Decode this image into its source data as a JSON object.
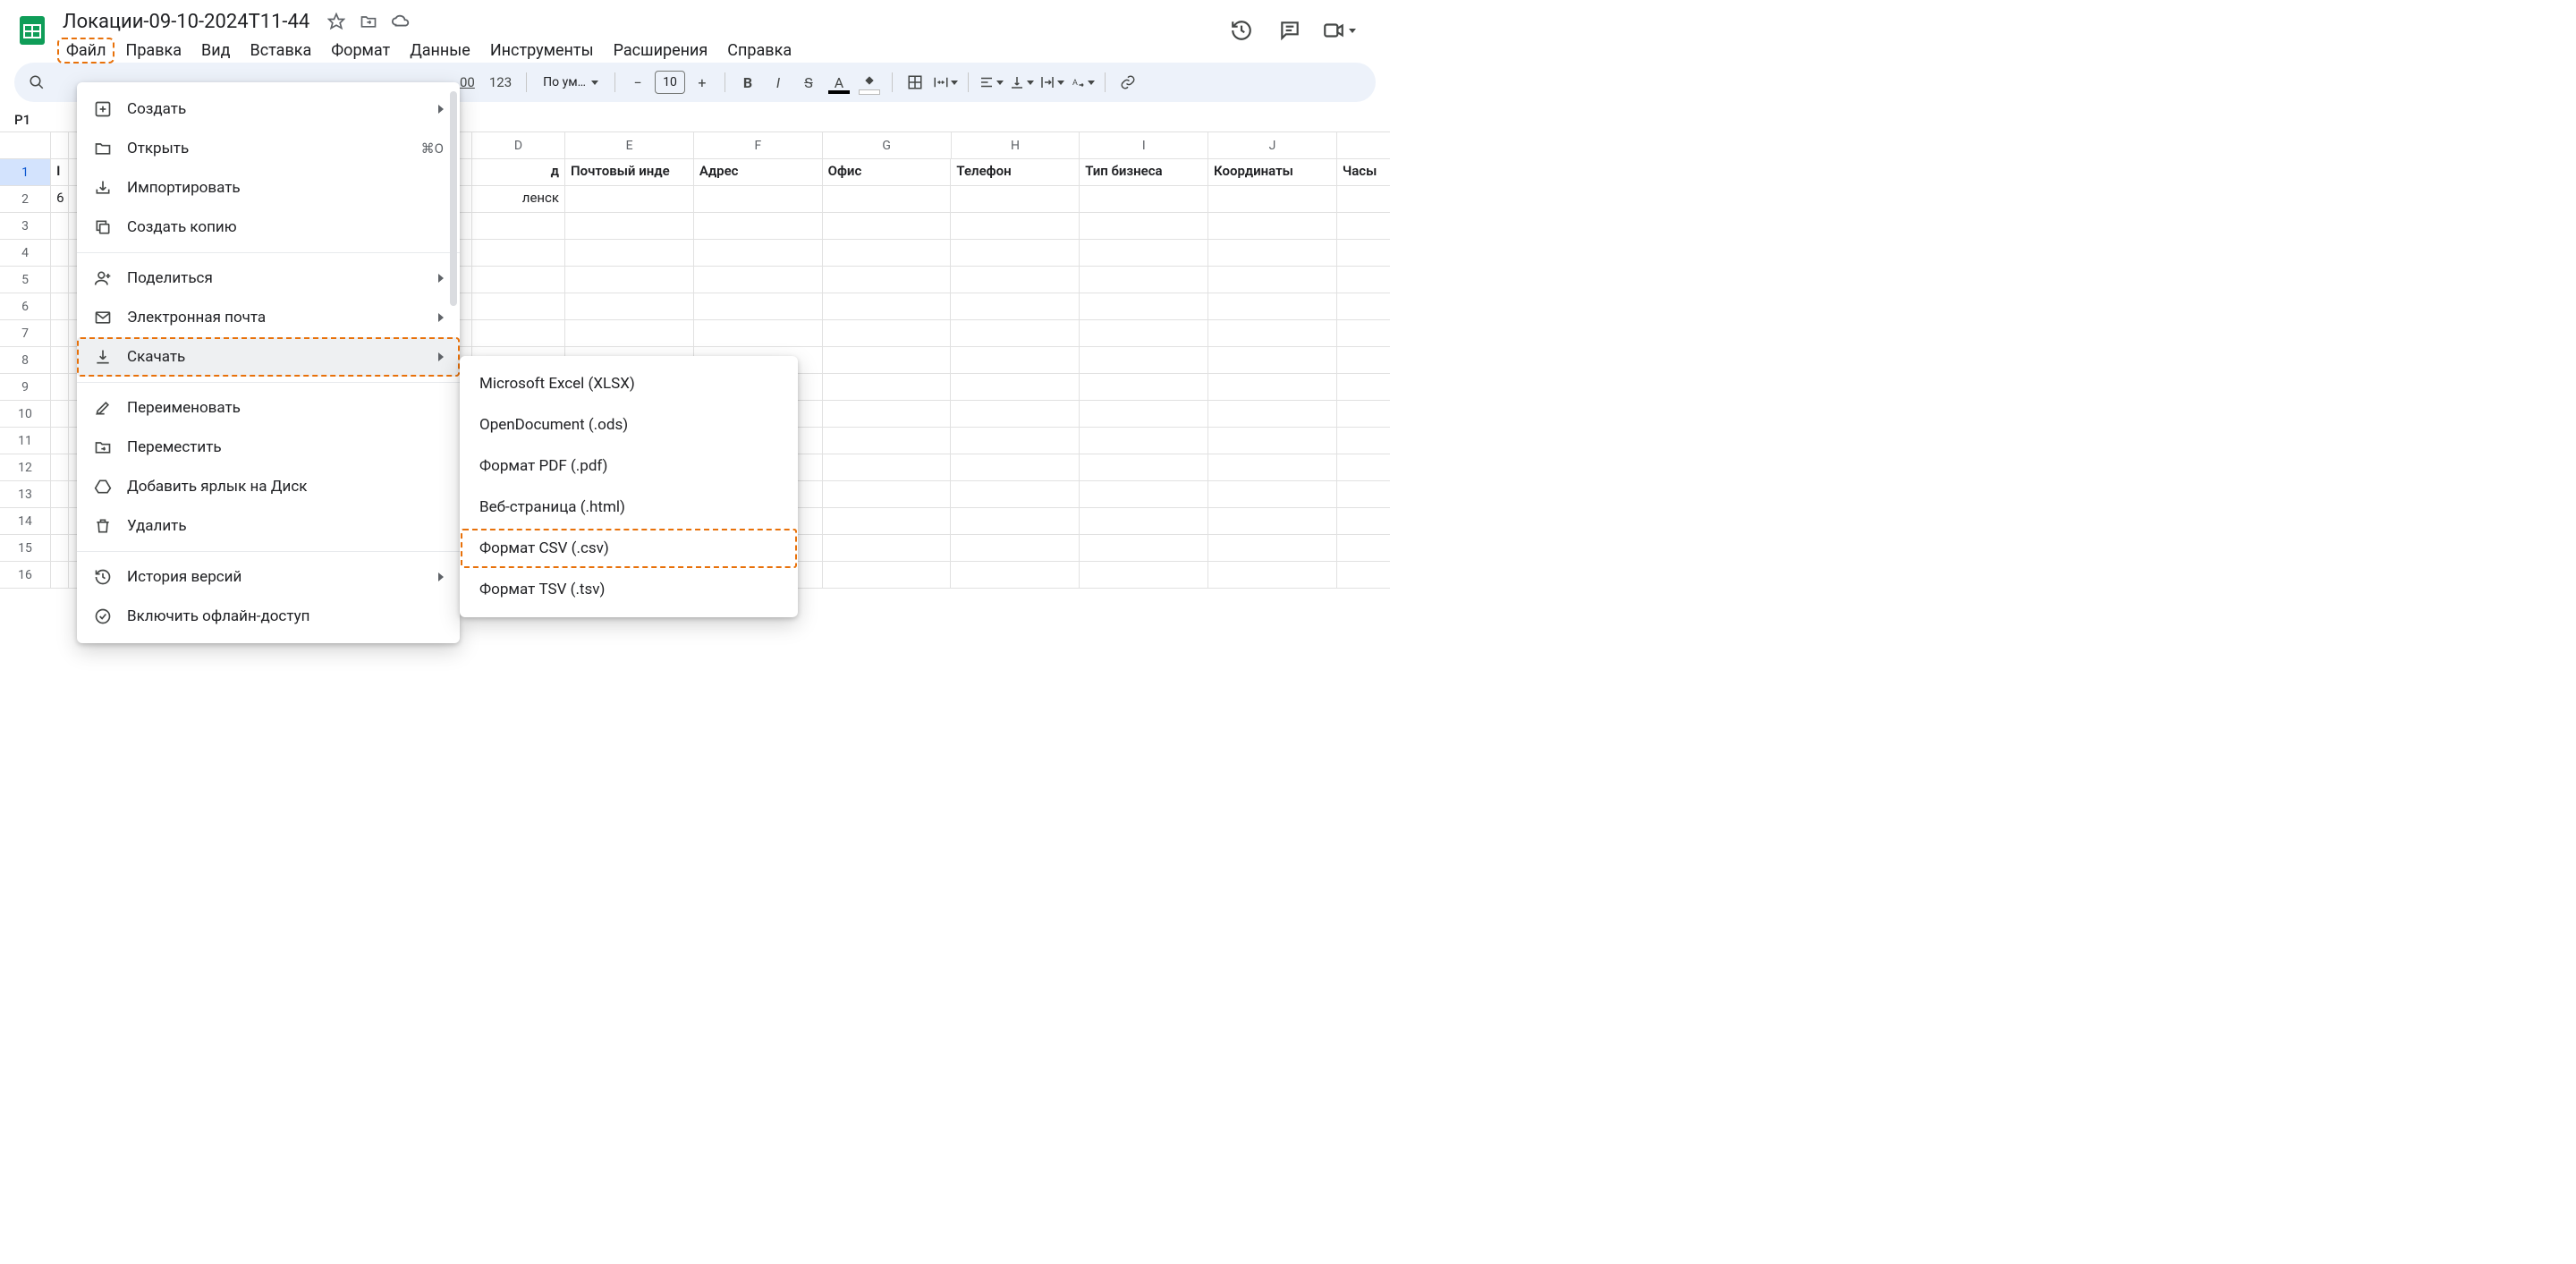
{
  "doc": {
    "title": "Локации-09-10-2024T11-44"
  },
  "menubar": [
    "Файл",
    "Правка",
    "Вид",
    "Вставка",
    "Формат",
    "Данные",
    "Инструменты",
    "Расширения",
    "Справка"
  ],
  "toolbar": {
    "decimal_inc": ".00",
    "number_fmt": "123",
    "font_label": "По ум…",
    "font_size": "10"
  },
  "namebox": "P1",
  "columns": [
    "D",
    "E",
    "F",
    "G",
    "H",
    "I",
    "J"
  ],
  "rows": [
    "1",
    "2",
    "3",
    "4",
    "5",
    "6",
    "7",
    "8",
    "9",
    "10",
    "11",
    "12",
    "13",
    "14",
    "15",
    "16"
  ],
  "headers_row": {
    "a_partial": "I",
    "d_partial": "д",
    "e": "Почтовый инде",
    "f": "Адрес",
    "g": "Офис",
    "h": "Телефон",
    "i": "Тип бизнеса",
    "j": "Координаты",
    "k_partial": "Часы"
  },
  "data_row2": {
    "a_partial": "6",
    "d_partial": "ленск"
  },
  "file_menu": {
    "items": [
      {
        "icon": "plus-box",
        "label": "Создать",
        "arrow": true
      },
      {
        "icon": "folder",
        "label": "Открыть",
        "shortcut": "⌘O"
      },
      {
        "icon": "import",
        "label": "Импортировать"
      },
      {
        "icon": "copy",
        "label": "Создать копию"
      },
      "sep",
      {
        "icon": "person-plus",
        "label": "Поделиться",
        "arrow": true
      },
      {
        "icon": "mail",
        "label": "Электронная почта",
        "arrow": true
      },
      {
        "icon": "download",
        "label": "Скачать",
        "arrow": true,
        "highlighted": true,
        "hover": true
      },
      "sep",
      {
        "icon": "pencil",
        "label": "Переименовать"
      },
      {
        "icon": "move",
        "label": "Переместить"
      },
      {
        "icon": "drive-shortcut",
        "label": "Добавить ярлык на Диск"
      },
      {
        "icon": "trash",
        "label": "Удалить"
      },
      "sep",
      {
        "icon": "history",
        "label": "История версий",
        "arrow": true
      },
      {
        "icon": "offline",
        "label": "Включить офлайн-доступ"
      }
    ]
  },
  "download_submenu": [
    {
      "label": "Microsoft Excel (XLSX)"
    },
    {
      "label": "OpenDocument (.ods)"
    },
    {
      "label": "Формат PDF (.pdf)"
    },
    {
      "label": "Веб-страница (.html)"
    },
    {
      "label": "Формат CSV (.csv)",
      "highlighted": true
    },
    {
      "label": "Формат TSV (.tsv)"
    }
  ]
}
